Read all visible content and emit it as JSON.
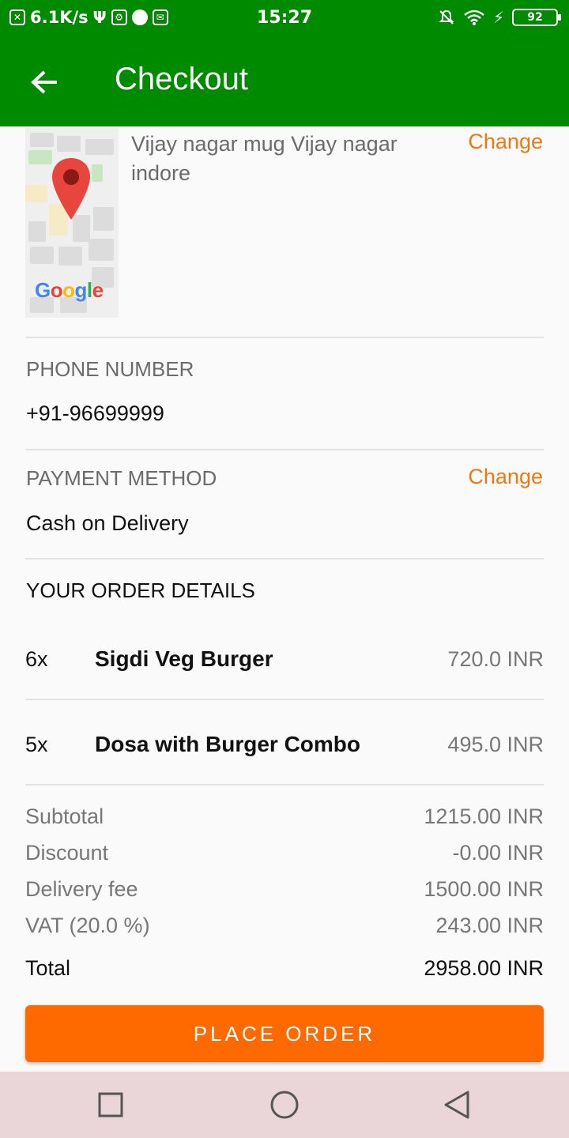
{
  "status_bar": {
    "net_speed": "6.1K/s",
    "time": "15:27",
    "battery": "92",
    "icons": [
      "xls-icon",
      "usb-icon",
      "usb-debug-icon",
      "speed-icon",
      "mail-icon",
      "mute-bell-icon",
      "wifi-icon",
      "charging-icon",
      "battery-icon"
    ]
  },
  "app_bar": {
    "title": "Checkout",
    "back_icon": "arrow-left-icon",
    "background": "#008a00"
  },
  "address": {
    "text": "Vijay nagar mug Vijay nagar indore",
    "change_label": "Change",
    "map_logo": "Google"
  },
  "phone": {
    "label": "PHONE NUMBER",
    "value": "+91-96699999"
  },
  "payment": {
    "label": "PAYMENT METHOD",
    "value": "Cash on Delivery",
    "change_label": "Change"
  },
  "order": {
    "heading": "YOUR ORDER DETAILS",
    "items": [
      {
        "qty": "6x",
        "name": "Sigdi Veg Burger",
        "price": "720.0 INR"
      },
      {
        "qty": "5x",
        "name": "Dosa with Burger Combo",
        "price": "495.0 INR"
      }
    ]
  },
  "summary": {
    "subtotal_label": "Subtotal",
    "subtotal_value": "1215.00 INR",
    "discount_label": "Discount",
    "discount_value": "-0.00 INR",
    "delivery_label": "Delivery fee",
    "delivery_value": "1500.00 INR",
    "vat_label": "VAT (20.0 %)",
    "vat_value": "243.00 INR",
    "total_label": "Total",
    "total_value": "2958.00 INR"
  },
  "place_order_label": "PLACE ORDER",
  "colors": {
    "accent": "#ff6a00",
    "link": "#ee7711",
    "header": "#008a00"
  },
  "nav_bar": {
    "icons": [
      "recents-square-icon",
      "home-circle-icon",
      "back-triangle-icon"
    ]
  }
}
